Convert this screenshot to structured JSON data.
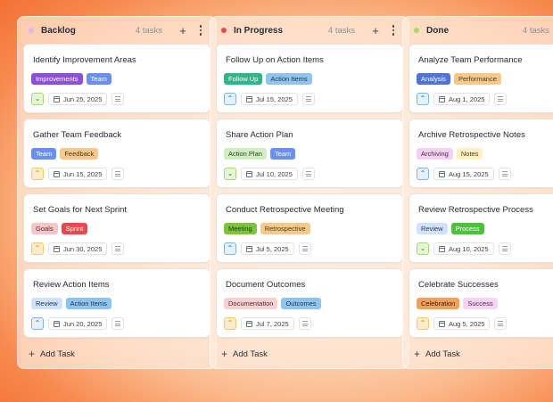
{
  "columns": [
    {
      "title": "Backlog",
      "count": "4 tasks",
      "dot": "#e3b6e6",
      "add": "+",
      "add_task": "Add Task",
      "cards": [
        {
          "title": "Identify Improvement Areas",
          "prio": "low",
          "date": "Jun 25, 2025",
          "tags": [
            {
              "label": "Improvements",
              "bg": "#8b4fd9",
              "fg": "#ffffff"
            },
            {
              "label": "Team",
              "bg": "#6a8ff0",
              "fg": "#ffffff"
            }
          ]
        },
        {
          "title": "Gather Team Feedback",
          "prio": "high",
          "date": "Jun 15, 2025",
          "tags": [
            {
              "label": "Team",
              "bg": "#6a8ff0",
              "fg": "#ffffff"
            },
            {
              "label": "Feedback",
              "bg": "#f6c98a",
              "fg": "#4a3a20"
            }
          ]
        },
        {
          "title": "Set Goals for Next Sprint",
          "prio": "high",
          "date": "Jun 30, 2025",
          "tags": [
            {
              "label": "Goals",
              "bg": "#f6c6c6",
              "fg": "#5a2a2a"
            },
            {
              "label": "Sprint",
              "bg": "#e5484d",
              "fg": "#ffffff"
            }
          ]
        },
        {
          "title": "Review Action Items",
          "prio": "medium",
          "date": "Jun 20, 2025",
          "tags": [
            {
              "label": "Review",
              "bg": "#cfe3fb",
              "fg": "#2a3a5a"
            },
            {
              "label": "Action Items",
              "bg": "#8fc4ee",
              "fg": "#1f3550"
            }
          ]
        }
      ]
    },
    {
      "title": "In Progress",
      "count": "4 tasks",
      "dot": "#e5484d",
      "add": "+",
      "add_task": "Add Task",
      "cards": [
        {
          "title": "Follow Up on Action Items",
          "prio": "medium",
          "date": "Jul 15, 2025",
          "tags": [
            {
              "label": "Follow Up",
              "bg": "#2fb58a",
              "fg": "#ffffff"
            },
            {
              "label": "Action Items",
              "bg": "#8fc4ee",
              "fg": "#1f3550"
            }
          ]
        },
        {
          "title": "Share Action Plan",
          "prio": "low",
          "date": "Jul 10, 2025",
          "tags": [
            {
              "label": "Action Plan",
              "bg": "#cfeec2",
              "fg": "#2a4a20"
            },
            {
              "label": "Team",
              "bg": "#6a8ff0",
              "fg": "#ffffff"
            }
          ]
        },
        {
          "title": "Conduct Retrospective Meeting",
          "prio": "medium",
          "date": "Jul 5, 2025",
          "tags": [
            {
              "label": "Meeting",
              "bg": "#7cc43c",
              "fg": "#1f3a10"
            },
            {
              "label": "Retrospective",
              "bg": "#f6c98a",
              "fg": "#4a3a20"
            }
          ]
        },
        {
          "title": "Document Outcomes",
          "prio": "high",
          "date": "Jul 7, 2025",
          "tags": [
            {
              "label": "Documentation",
              "bg": "#f6d2d2",
              "fg": "#5a2a2a"
            },
            {
              "label": "Outcomes",
              "bg": "#8fc4ee",
              "fg": "#1f3550"
            }
          ]
        }
      ]
    },
    {
      "title": "Done",
      "count": "4 tasks",
      "dot": "#a6d96a",
      "add": "+",
      "add_task": "Add Task",
      "cards": [
        {
          "title": "Analyze Team Performance",
          "prio": "medium",
          "date": "Aug 1, 2025",
          "tags": [
            {
              "label": "Analysis",
              "bg": "#4f73d9",
              "fg": "#ffffff"
            },
            {
              "label": "Performance",
              "bg": "#f6c98a",
              "fg": "#4a3a20"
            }
          ]
        },
        {
          "title": "Archive Retrospective Notes",
          "prio": "medium",
          "date": "Aug 15, 2025",
          "tags": [
            {
              "label": "Archiving",
              "bg": "#f5d0f0",
              "fg": "#4a2a4a"
            },
            {
              "label": "Notes",
              "bg": "#fdf1c4",
              "fg": "#4a4020"
            }
          ]
        },
        {
          "title": "Review Retrospective Process",
          "prio": "low",
          "date": "Aug 10, 2025",
          "tags": [
            {
              "label": "Review",
              "bg": "#cfe3fb",
              "fg": "#2a3a5a"
            },
            {
              "label": "Process",
              "bg": "#4cc23c",
              "fg": "#ffffff"
            }
          ]
        },
        {
          "title": "Celebrate Successes",
          "prio": "high",
          "date": "Aug 5, 2025",
          "tags": [
            {
              "label": "Celebration",
              "bg": "#f5a05a",
              "fg": "#3a2410"
            },
            {
              "label": "Success",
              "bg": "#f7d4f3",
              "fg": "#4a2a4a"
            }
          ]
        }
      ]
    }
  ],
  "priority_icons": {
    "low": {
      "glyph": "⌄",
      "bg": "#e6f6d8",
      "border": "#a6d96a",
      "fg": "#4a8a2a"
    },
    "medium": {
      "glyph": "⌃",
      "bg": "#e3f1fb",
      "border": "#7ab8e8",
      "fg": "#2a6ea8"
    },
    "high": {
      "glyph": "⌃",
      "bg": "#fdecc8",
      "border": "#f5c86a",
      "fg": "#c08a1a"
    }
  }
}
